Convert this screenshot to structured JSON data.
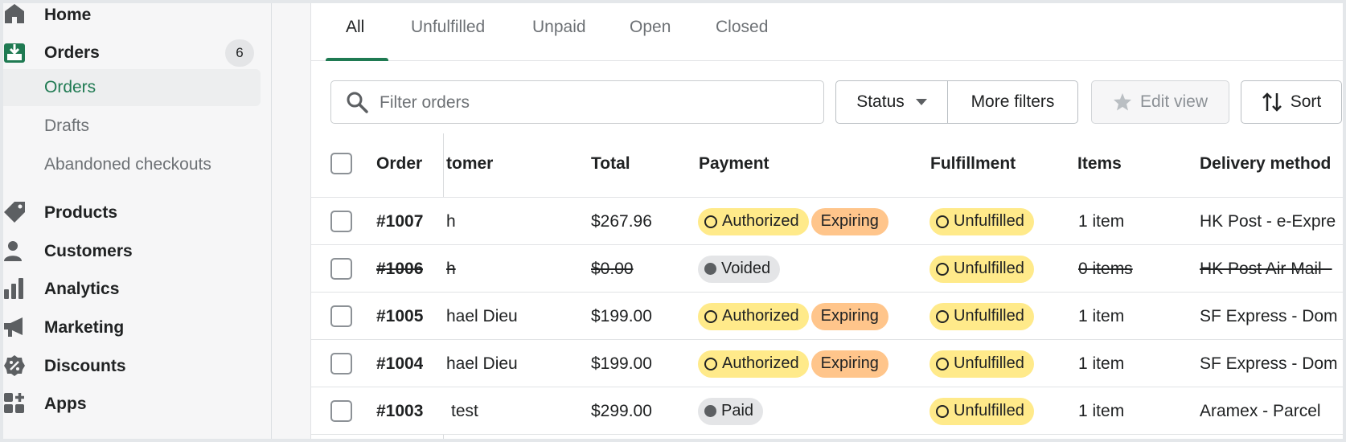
{
  "sidebar": {
    "home": "Home",
    "orders": "Orders",
    "orders_count": "6",
    "sub_orders": "Orders",
    "sub_drafts": "Drafts",
    "sub_abandoned": "Abandoned checkouts",
    "products": "Products",
    "customers": "Customers",
    "analytics": "Analytics",
    "marketing": "Marketing",
    "discounts": "Discounts",
    "apps": "Apps"
  },
  "tabs": [
    "All",
    "Unfulfilled",
    "Unpaid",
    "Open",
    "Closed"
  ],
  "toolbar": {
    "search_placeholder": "Filter orders",
    "status": "Status",
    "more_filters": "More filters",
    "edit_view": "Edit view",
    "sort": "Sort"
  },
  "table": {
    "headers": {
      "order": "Order",
      "customer": "tomer",
      "total": "Total",
      "payment": "Payment",
      "fulfillment": "Fulfillment",
      "items": "Items",
      "delivery": "Delivery method"
    },
    "rows": [
      {
        "order": "#1007",
        "customer": "h",
        "total": "$267.96",
        "payment": "Authorized",
        "expiring": "Expiring",
        "fulfillment": "Unfulfilled",
        "items": "1 item",
        "delivery": "HK Post - e-Expre"
      },
      {
        "order": "#1006",
        "customer": "h",
        "total": "$0.00",
        "payment": "Voided",
        "expiring": "",
        "fulfillment": "Unfulfilled",
        "items": "0 items",
        "delivery": "HK Post Air Mail - "
      },
      {
        "order": "#1005",
        "customer": "hael Dieu",
        "total": "$199.00",
        "payment": "Authorized",
        "expiring": "Expiring",
        "fulfillment": "Unfulfilled",
        "items": "1 item",
        "delivery": "SF Express - Dom"
      },
      {
        "order": "#1004",
        "customer": "hael Dieu",
        "total": "$199.00",
        "payment": "Authorized",
        "expiring": "Expiring",
        "fulfillment": "Unfulfilled",
        "items": "1 item",
        "delivery": "SF Express - Dom"
      },
      {
        "order": "#1003",
        "customer": "test",
        "total": "$299.00",
        "payment": "Paid",
        "expiring": "",
        "fulfillment": "Unfulfilled",
        "items": "1 item",
        "delivery": "Aramex - Parcel"
      }
    ]
  },
  "colors": {
    "accent": "#1f7a52",
    "pill_yellow": "#ffea8a",
    "pill_orange": "#ffc58b",
    "pill_grey": "#e4e5e7"
  }
}
